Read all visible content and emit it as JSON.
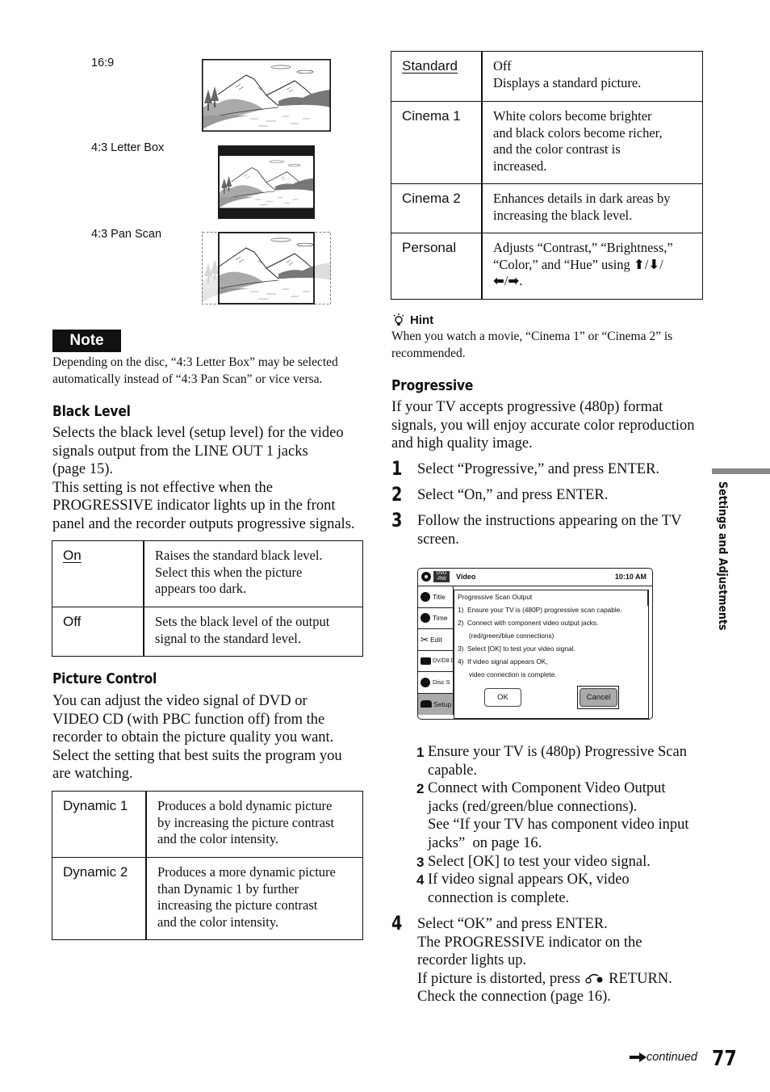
{
  "aspect_ratio": {
    "options": [
      {
        "label": "16:9"
      },
      {
        "label": "4:3 Letter Box"
      },
      {
        "label": "4:3 Pan Scan"
      }
    ]
  },
  "note": {
    "badge": "Note",
    "text_line1": "Depending on the disc, “4:3 Letter Box” may be selected",
    "text_line2": "automatically instead of “4:3 Pan Scan” or vice versa."
  },
  "black_level": {
    "heading": "Black Level",
    "paragraph_lines": [
      "Selects the black level (setup level) for the video",
      "signals output from the LINE OUT 1 jacks",
      "(page 15).",
      "This setting is not effective when the",
      "PROGRESSIVE indicator lights up in the front",
      "panel and the recorder outputs progressive signals."
    ],
    "table": [
      {
        "option": "On",
        "default": true,
        "lines": [
          "Raises the standard black level.",
          "Select this when the picture",
          "appears too dark."
        ]
      },
      {
        "option": "Off",
        "default": false,
        "lines": [
          "Sets the black level of the output",
          "signal to the standard level."
        ]
      }
    ]
  },
  "picture_control": {
    "heading": "Picture Control",
    "paragraph_lines": [
      "You can adjust the video signal of DVD or",
      "VIDEO CD (with PBC function off) from the",
      "recorder to obtain the picture quality you want.",
      "Select the setting that best suits the program you",
      "are watching."
    ],
    "table_left": [
      {
        "option": "Dynamic 1",
        "lines": [
          "Produces a bold dynamic picture",
          "by increasing the picture contrast",
          "and the color intensity."
        ]
      },
      {
        "option": "Dynamic 2",
        "lines": [
          "Produces a more dynamic picture",
          "than Dynamic 1 by further",
          "increasing the picture contrast",
          "and the color intensity."
        ]
      }
    ],
    "table_right": [
      {
        "option": "Standard",
        "default": true,
        "lines": [
          "Off",
          "Displays a standard picture."
        ]
      },
      {
        "option": "Cinema 1",
        "default": false,
        "lines": [
          "White colors become brighter",
          "and black colors become richer,",
          "and the color contrast is",
          "increased."
        ]
      },
      {
        "option": "Cinema 2",
        "default": false,
        "lines": [
          "Enhances details in dark areas by",
          "increasing the black level."
        ]
      },
      {
        "option": "Personal",
        "default": false,
        "lines": [
          "Adjusts “Contrast,” “Brightness,”",
          "“Color,” and “Hue” using ",
          "."
        ]
      }
    ],
    "arrows": {
      "up": "🠉",
      "down": "🠋",
      "left": "🠈",
      "right": "🠊"
    }
  },
  "hint": {
    "title": "Hint",
    "line1": "When you watch a movie, “Cinema 1” or “Cinema 2” is",
    "line2": "recommended."
  },
  "progressive": {
    "heading": "Progressive",
    "paragraph_lines": [
      "If your TV accepts progressive (480p) format",
      "signals, you will enjoy accurate color reproduction",
      "and high quality image."
    ],
    "steps": [
      {
        "num": "1",
        "lines": [
          "Select “Progressive,” and press ENTER."
        ]
      },
      {
        "num": "2",
        "lines": [
          "Select “On,” and press ENTER."
        ]
      },
      {
        "num": "3",
        "lines": [
          "Follow the instructions appearing on the TV",
          "screen."
        ]
      }
    ],
    "osd": {
      "disc_badge": "DVD\n-RW",
      "title": "Video",
      "time": "10:10 AM",
      "sidebar": [
        "Title",
        "Time",
        "Edit",
        "DV/D8 D",
        "Disc S",
        "Setup"
      ],
      "selected_sidebar": "Setup",
      "dialog": {
        "title": "Progressive Scan Output",
        "lines": [
          "1)  Ensure your TV is (480P) progressive scan capable.",
          "2)  Connect with component video output jacks.",
          "      (red/green/blue connections)",
          "3)  Select [OK] to test your video signal.",
          "4)  If video signal appears OK,",
          "      video connection is complete."
        ],
        "ok_button": "OK",
        "cancel_button": "Cancel",
        "focused_button": "Cancel"
      }
    },
    "sub_steps": [
      {
        "num": "1",
        "lines": [
          "Ensure your TV is (480p) Progressive Scan",
          "capable."
        ]
      },
      {
        "num": "2",
        "lines": [
          "Connect with Component Video Output",
          "jacks (red/green/blue connections).",
          "See “If your TV has component video input",
          "jacks”  on page 16."
        ]
      },
      {
        "num": "3",
        "lines": [
          "Select [OK] to test your video signal."
        ]
      },
      {
        "num": "4",
        "lines": [
          "If video signal appears OK, video",
          "connection is complete."
        ]
      }
    ],
    "step4": {
      "num": "4",
      "lines": [
        "Select “OK” and press ENTER.",
        "The PROGRESSIVE indicator on the",
        "recorder lights up.",
        "If picture is distorted, press ",
        "Check the connection (page 16)."
      ],
      "return_label": " RETURN."
    }
  },
  "side_tab": {
    "label": "Settings and Adjustments"
  },
  "footer": {
    "continued": "continued",
    "page_number": "77"
  }
}
